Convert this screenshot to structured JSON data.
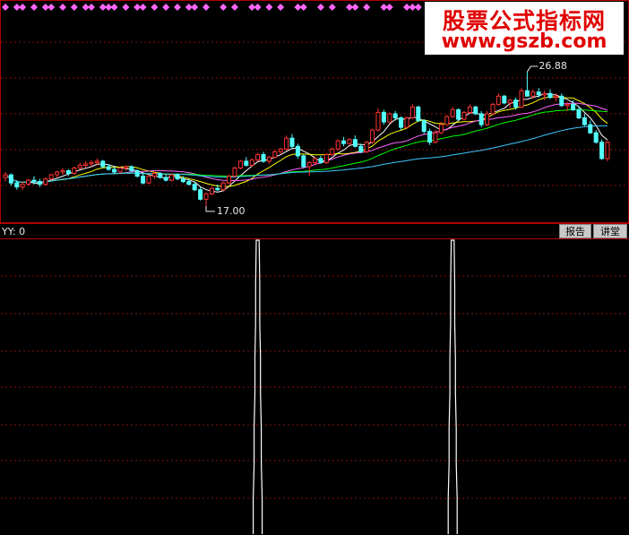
{
  "watermark": {
    "site_name": "股票公式指标网",
    "url": "www.gszb.com"
  },
  "lower_panel": {
    "indicator_label": "YY: 0",
    "buttons": {
      "report": "报告",
      "lecture": "讲堂"
    }
  },
  "colors": {
    "up": "#ff3232",
    "down": "#54ffff",
    "ma5": "#ffffff",
    "ma10": "#ffff00",
    "ma20": "#ff66ff",
    "ma30": "#00ff00",
    "ma60": "#3ec6ff",
    "grid": "#8a1010",
    "signal": "#ff66ff",
    "indicator_line": "#ffffff"
  },
  "chart_data": [
    {
      "type": "candlestick",
      "title": "",
      "price_annotations": {
        "high": "26.88",
        "low": "17.00"
      },
      "ylim": [
        16.0,
        31.0
      ],
      "signal_marks": [
        0,
        2,
        3,
        5,
        7,
        8,
        10,
        12,
        14,
        15,
        17,
        18,
        19,
        21,
        23,
        24,
        26,
        28,
        30,
        32,
        33,
        35,
        38,
        40,
        43,
        44,
        46,
        48,
        51,
        52,
        55,
        57,
        60,
        61,
        63,
        66,
        67,
        70,
        71,
        72,
        74,
        77,
        79,
        82,
        84,
        85,
        86,
        88,
        90,
        94,
        96,
        98,
        100,
        101,
        104,
        105
      ],
      "candles": [
        [
          19.1,
          19.5,
          18.8,
          19.3
        ],
        [
          19.3,
          19.4,
          18.5,
          18.7
        ],
        [
          18.7,
          18.9,
          18.2,
          18.4
        ],
        [
          18.4,
          18.8,
          18.2,
          18.6
        ],
        [
          18.6,
          19.0,
          18.5,
          18.9
        ],
        [
          18.9,
          19.2,
          18.6,
          18.8
        ],
        [
          18.8,
          19.0,
          18.4,
          18.6
        ],
        [
          18.6,
          19.1,
          18.5,
          19.0
        ],
        [
          19.0,
          19.4,
          18.9,
          19.3
        ],
        [
          19.3,
          19.6,
          19.1,
          19.5
        ],
        [
          19.5,
          19.8,
          19.3,
          19.6
        ],
        [
          19.6,
          19.7,
          19.2,
          19.4
        ],
        [
          19.4,
          19.9,
          19.3,
          19.8
        ],
        [
          19.8,
          20.2,
          19.7,
          20.0
        ],
        [
          20.0,
          20.3,
          19.8,
          20.1
        ],
        [
          20.1,
          20.4,
          19.9,
          20.2
        ],
        [
          20.2,
          20.5,
          20.0,
          20.3
        ],
        [
          20.3,
          20.4,
          19.8,
          19.9
        ],
        [
          19.9,
          20.1,
          19.6,
          19.7
        ],
        [
          19.7,
          19.9,
          19.4,
          19.5
        ],
        [
          19.5,
          19.9,
          19.4,
          19.8
        ],
        [
          19.8,
          20.0,
          19.6,
          19.9
        ],
        [
          19.9,
          20.0,
          19.5,
          19.6
        ],
        [
          19.6,
          19.7,
          19.1,
          19.2
        ],
        [
          19.2,
          19.4,
          18.6,
          18.7
        ],
        [
          18.7,
          19.3,
          18.6,
          19.2
        ],
        [
          19.2,
          19.5,
          19.0,
          19.4
        ],
        [
          19.4,
          19.5,
          19.0,
          19.1
        ],
        [
          19.1,
          19.3,
          18.8,
          18.9
        ],
        [
          18.9,
          19.4,
          18.8,
          19.3
        ],
        [
          19.3,
          19.4,
          18.9,
          19.0
        ],
        [
          19.0,
          19.2,
          18.7,
          18.8
        ],
        [
          18.8,
          19.0,
          18.5,
          18.6
        ],
        [
          18.6,
          18.8,
          18.1,
          18.2
        ],
        [
          18.2,
          18.4,
          17.4,
          17.5
        ],
        [
          17.5,
          18.0,
          17.0,
          17.9
        ],
        [
          17.9,
          18.4,
          17.8,
          18.3
        ],
        [
          18.3,
          18.6,
          18.1,
          18.2
        ],
        [
          18.2,
          18.8,
          18.1,
          18.7
        ],
        [
          18.7,
          19.3,
          18.6,
          19.2
        ],
        [
          19.2,
          19.9,
          19.1,
          19.8
        ],
        [
          19.8,
          20.4,
          19.7,
          20.3
        ],
        [
          20.3,
          20.6,
          19.9,
          20.0
        ],
        [
          20.0,
          20.5,
          19.9,
          20.4
        ],
        [
          20.4,
          20.9,
          20.3,
          20.8
        ],
        [
          20.8,
          21.0,
          20.2,
          20.3
        ],
        [
          20.3,
          20.7,
          20.1,
          20.6
        ],
        [
          20.6,
          21.1,
          20.5,
          21.0
        ],
        [
          21.0,
          21.3,
          20.8,
          21.2
        ],
        [
          21.2,
          22.2,
          21.1,
          22.0
        ],
        [
          22.0,
          22.3,
          21.2,
          21.4
        ],
        [
          21.4,
          21.6,
          20.5,
          20.7
        ],
        [
          20.7,
          20.8,
          19.8,
          19.9
        ],
        [
          19.9,
          20.3,
          19.2,
          20.2
        ],
        [
          20.2,
          20.6,
          20.0,
          20.5
        ],
        [
          20.5,
          20.7,
          20.1,
          20.2
        ],
        [
          20.2,
          20.9,
          20.1,
          20.8
        ],
        [
          20.8,
          21.3,
          20.7,
          21.2
        ],
        [
          21.2,
          21.9,
          21.1,
          21.8
        ],
        [
          21.8,
          22.1,
          21.4,
          21.6
        ],
        [
          21.6,
          22.0,
          21.5,
          21.9
        ],
        [
          21.9,
          22.2,
          21.3,
          21.4
        ],
        [
          21.4,
          21.6,
          20.9,
          21.0
        ],
        [
          21.0,
          21.8,
          20.9,
          21.7
        ],
        [
          21.7,
          22.7,
          21.6,
          22.6
        ],
        [
          22.6,
          24.2,
          22.5,
          23.9
        ],
        [
          23.9,
          24.1,
          23.0,
          23.2
        ],
        [
          23.2,
          23.9,
          23.1,
          23.8
        ],
        [
          23.8,
          24.0,
          23.3,
          23.5
        ],
        [
          23.5,
          23.6,
          22.6,
          22.8
        ],
        [
          22.8,
          23.6,
          22.7,
          23.5
        ],
        [
          23.5,
          24.5,
          23.4,
          24.3
        ],
        [
          24.3,
          24.4,
          23.2,
          23.3
        ],
        [
          23.3,
          23.4,
          22.3,
          22.5
        ],
        [
          22.5,
          22.7,
          21.5,
          21.7
        ],
        [
          21.7,
          22.6,
          21.6,
          22.4
        ],
        [
          22.4,
          23.2,
          22.3,
          23.0
        ],
        [
          23.0,
          23.7,
          22.9,
          23.6
        ],
        [
          23.6,
          24.3,
          23.5,
          24.1
        ],
        [
          24.1,
          24.2,
          23.3,
          23.4
        ],
        [
          23.4,
          24.0,
          23.3,
          23.9
        ],
        [
          23.9,
          24.5,
          23.8,
          24.3
        ],
        [
          24.3,
          24.4,
          23.7,
          23.8
        ],
        [
          23.8,
          24.0,
          22.8,
          23.0
        ],
        [
          23.0,
          24.0,
          22.9,
          23.8
        ],
        [
          23.8,
          24.6,
          23.7,
          24.5
        ],
        [
          24.5,
          25.3,
          24.4,
          25.1
        ],
        [
          25.1,
          25.2,
          24.5,
          24.6
        ],
        [
          24.6,
          24.9,
          24.2,
          24.8
        ],
        [
          24.8,
          25.0,
          24.1,
          24.3
        ],
        [
          24.3,
          25.7,
          24.2,
          25.5
        ],
        [
          25.5,
          26.9,
          25.3,
          25.1
        ],
        [
          25.1,
          25.6,
          24.9,
          25.4
        ],
        [
          25.4,
          25.7,
          25.0,
          25.2
        ],
        [
          25.2,
          25.5,
          24.8,
          25.3
        ],
        [
          25.3,
          25.6,
          24.9,
          25.0
        ],
        [
          25.0,
          25.3,
          24.7,
          25.1
        ],
        [
          25.1,
          25.3,
          24.3,
          24.4
        ],
        [
          24.4,
          24.7,
          24.0,
          24.5
        ],
        [
          24.5,
          24.8,
          24.0,
          24.1
        ],
        [
          24.1,
          24.3,
          23.4,
          23.5
        ],
        [
          23.5,
          23.8,
          22.9,
          23.0
        ],
        [
          23.0,
          23.3,
          22.3,
          22.4
        ],
        [
          22.4,
          22.6,
          21.6,
          21.7
        ],
        [
          21.7,
          21.9,
          20.4,
          20.5
        ],
        [
          20.5,
          21.8,
          20.3,
          21.7
        ]
      ],
      "moving_averages": [
        {
          "period": 5
        },
        {
          "period": 10
        },
        {
          "period": 20
        },
        {
          "period": 30
        },
        {
          "period": 60
        }
      ]
    },
    {
      "type": "line",
      "title": "",
      "ylabel": "",
      "ylim": [
        0,
        1
      ],
      "y": [
        0,
        0,
        0,
        0,
        0,
        0,
        0,
        0,
        0,
        0,
        0,
        0,
        0,
        0,
        0,
        0,
        0,
        0,
        0,
        0,
        0,
        0,
        0,
        0,
        0,
        0,
        0,
        0,
        0,
        0,
        0,
        0,
        0,
        0,
        0,
        0,
        0,
        0,
        0,
        0,
        0,
        0,
        0,
        0,
        1,
        0,
        0,
        0,
        0,
        0,
        0,
        0,
        0,
        0,
        0,
        0,
        0,
        0,
        0,
        0,
        0,
        0,
        0,
        0,
        0,
        0,
        0,
        0,
        0,
        0,
        0,
        0,
        0,
        0,
        0,
        0,
        0,
        0,
        1,
        0,
        0,
        0,
        0,
        0,
        0,
        0,
        0,
        0,
        0,
        0,
        0,
        0,
        0,
        0,
        0,
        0,
        0,
        0,
        0,
        0,
        0,
        0,
        0,
        0,
        0,
        0
      ]
    }
  ]
}
